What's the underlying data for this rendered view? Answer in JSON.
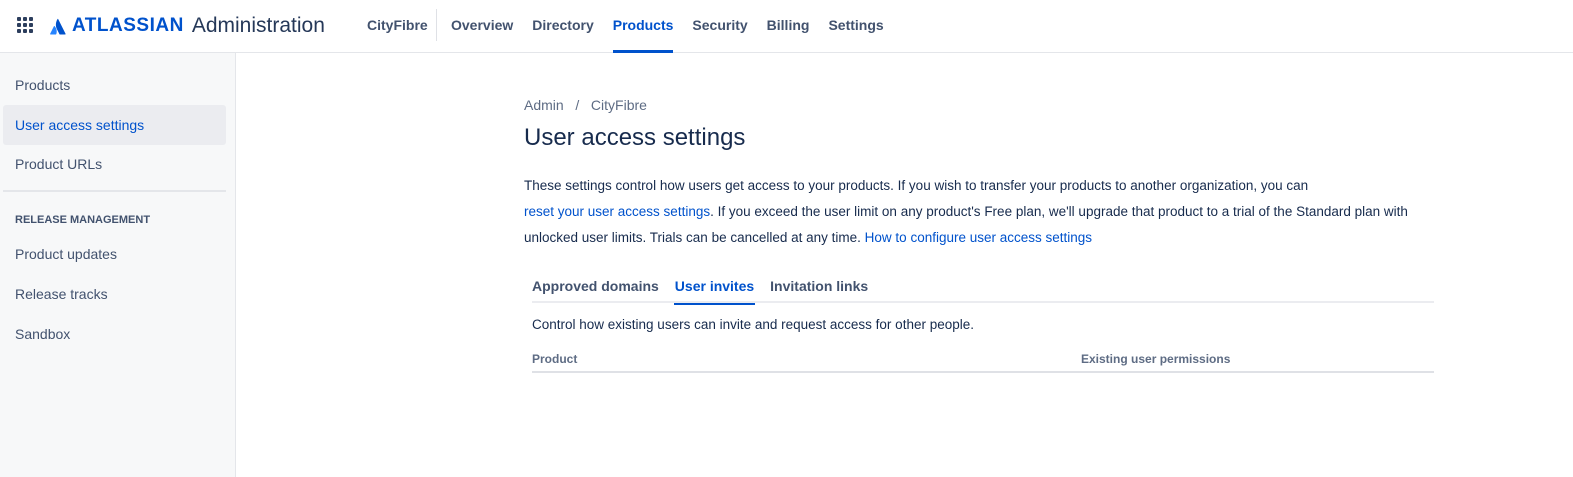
{
  "header": {
    "brand": "ATLASSIAN",
    "app": "Administration",
    "org": "CityFibre",
    "nav": [
      "Overview",
      "Directory",
      "Products",
      "Security",
      "Billing",
      "Settings"
    ],
    "active_nav": "Products"
  },
  "sidebar": {
    "items": [
      "Products",
      "User access settings",
      "Product URLs"
    ],
    "section": "RELEASE MANAGEMENT",
    "section_items": [
      "Product updates",
      "Release tracks",
      "Sandbox"
    ]
  },
  "main": {
    "breadcrumb": [
      "Admin",
      "CityFibre"
    ],
    "title": "User access settings",
    "para": {
      "p1": "These settings control how users get access to your products. If you wish to transfer your products to another organization, you can ",
      "link1": "reset your user access settings",
      "p2": ". If you exceed the user limit on any product's Free plan, we'll upgrade that product to a trial of the Standard plan with unlocked user limits. Trials can be cancelled at any time. ",
      "link2": "How to configure user access settings"
    },
    "tabs": [
      "Approved domains",
      "User invites",
      "Invitation links"
    ],
    "description": "Control how existing users can invite and request access for other people.",
    "columns": [
      "Product",
      "Existing user permissions"
    ]
  }
}
